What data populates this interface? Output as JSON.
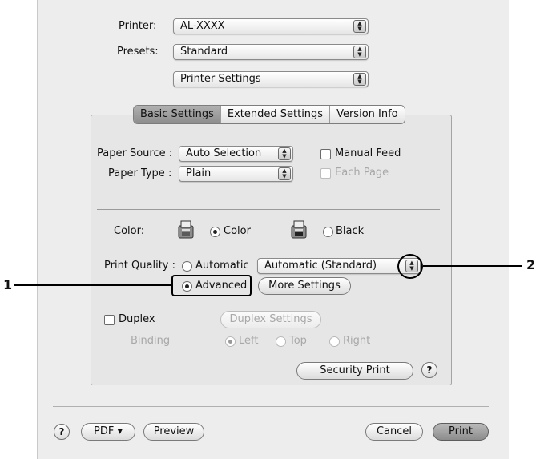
{
  "header": {
    "printer_label": "Printer:",
    "printer_value": "AL-XXXX",
    "presets_label": "Presets:",
    "presets_value": "Standard",
    "panel_value": "Printer Settings"
  },
  "tabs": [
    {
      "label": "Basic Settings",
      "selected": true
    },
    {
      "label": "Extended Settings",
      "selected": false
    },
    {
      "label": "Version Info",
      "selected": false
    }
  ],
  "paper": {
    "source_label": "Paper Source :",
    "source_value": "Auto Selection",
    "type_label": "Paper Type :",
    "type_value": "Plain",
    "manual_feed_label": "Manual Feed",
    "each_page_label": "Each Page"
  },
  "color": {
    "label": "Color:",
    "color_option": "Color",
    "black_option": "Black",
    "selected": "Color"
  },
  "quality": {
    "label": "Print Quality :",
    "automatic_label": "Automatic",
    "advanced_label": "Advanced",
    "selected": "Advanced",
    "mode_value": "Automatic (Standard)",
    "more_settings_label": "More Settings"
  },
  "duplex": {
    "label": "Duplex",
    "settings_label": "Duplex Settings",
    "binding_label": "Binding",
    "left_label": "Left",
    "top_label": "Top",
    "right_label": "Right",
    "selected_binding": "Left"
  },
  "security_print_label": "Security Print",
  "footer": {
    "help_label": "?",
    "pdf_label": "PDF ▾",
    "preview_label": "Preview",
    "cancel_label": "Cancel",
    "print_label": "Print"
  },
  "callouts": {
    "one": "1",
    "two": "2"
  }
}
